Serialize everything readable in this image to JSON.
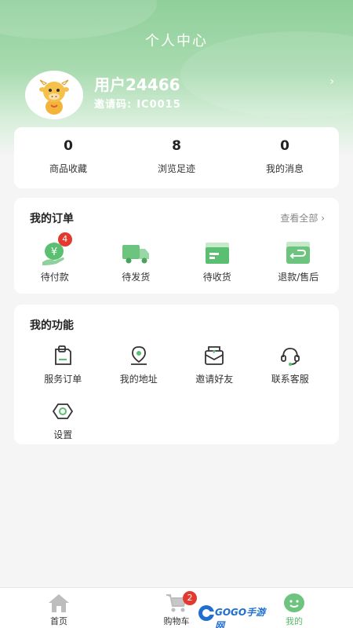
{
  "header": {
    "title": "个人中心"
  },
  "profile": {
    "username": "用户24466",
    "invite_label": "邀请码:",
    "invite_code": "IC0015",
    "chevron": "›"
  },
  "stats": [
    {
      "value": "0",
      "label": "商品收藏"
    },
    {
      "value": "8",
      "label": "浏览足迹"
    },
    {
      "value": "0",
      "label": "我的消息"
    }
  ],
  "orders": {
    "title": "我的订单",
    "view_all": "查看全部 ›",
    "items": [
      {
        "label": "待付款",
        "badge": "4",
        "icon": "payment-icon"
      },
      {
        "label": "待发货",
        "icon": "truck-icon"
      },
      {
        "label": "待收货",
        "icon": "package-icon"
      },
      {
        "label": "退款/售后",
        "icon": "refund-icon"
      }
    ]
  },
  "functions": {
    "title": "我的功能",
    "items": [
      {
        "label": "服务订单",
        "icon": "service-order-icon"
      },
      {
        "label": "我的地址",
        "icon": "location-icon"
      },
      {
        "label": "邀请好友",
        "icon": "invite-icon"
      },
      {
        "label": "联系客服",
        "icon": "headset-icon"
      },
      {
        "label": "设置",
        "icon": "settings-icon"
      }
    ]
  },
  "tabbar": {
    "items": [
      {
        "label": "首页",
        "icon": "home-icon"
      },
      {
        "label": "购物车",
        "icon": "cart-icon",
        "badge": "2"
      },
      {
        "label": "我的",
        "icon": "profile-smile-icon",
        "active": true
      }
    ]
  },
  "watermark": {
    "text": "GOGO手游网"
  },
  "colors": {
    "accent": "#59b86b",
    "badge": "#e23a2e",
    "header_green": "#8fcf9a"
  }
}
